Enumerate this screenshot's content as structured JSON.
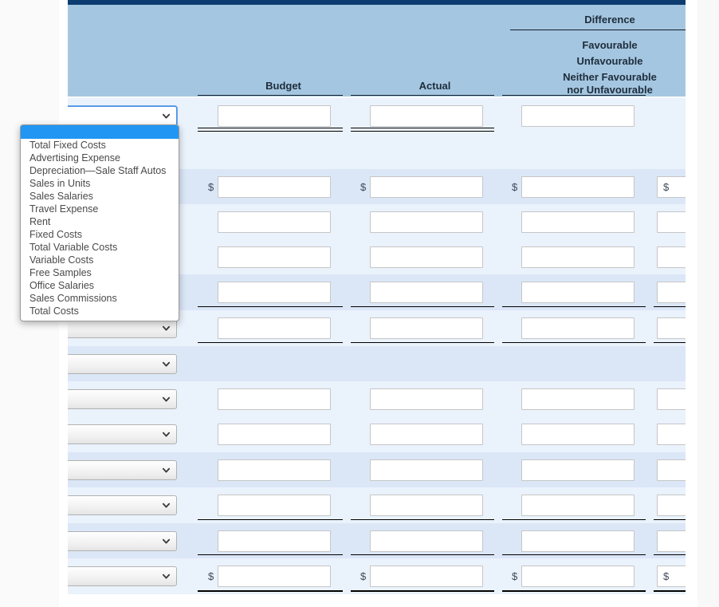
{
  "worksheet": {
    "column_headers": {
      "budget": "Budget",
      "actual": "Actual",
      "difference": "Difference",
      "difference_note_line1": "Favourable",
      "difference_note_line2": "Unfavourable",
      "difference_note_line3": "Neither Favourable",
      "difference_note_line4": "nor Unfavourable"
    },
    "row_currency_symbol": "$",
    "rows": [
      {
        "id": 1,
        "stripe": "light",
        "has_select": true,
        "select_focused": true,
        "inputs": 3,
        "dollar": false,
        "rule_below": "double"
      },
      {
        "id": 2,
        "stripe": "light",
        "has_select": false,
        "select_focused": false,
        "inputs": 0,
        "dollar": false,
        "rule_below": "none"
      },
      {
        "id": 3,
        "stripe": "dark",
        "has_select": true,
        "select_focused": false,
        "inputs": 4,
        "dollar": true,
        "rule_below": "none"
      },
      {
        "id": 4,
        "stripe": "light",
        "has_select": true,
        "select_focused": false,
        "inputs": 4,
        "dollar": false,
        "rule_below": "none"
      },
      {
        "id": 5,
        "stripe": "light",
        "has_select": true,
        "select_focused": false,
        "inputs": 4,
        "dollar": false,
        "rule_below": "none"
      },
      {
        "id": 6,
        "stripe": "dark",
        "has_select": true,
        "select_focused": false,
        "inputs": 4,
        "dollar": false,
        "rule_below": "single"
      },
      {
        "id": 7,
        "stripe": "light",
        "has_select": true,
        "select_focused": false,
        "inputs": 4,
        "dollar": false,
        "rule_below": "single"
      },
      {
        "id": 8,
        "stripe": "dark",
        "has_select": true,
        "select_focused": false,
        "inputs": 0,
        "dollar": false,
        "rule_below": "none"
      },
      {
        "id": 9,
        "stripe": "light",
        "has_select": true,
        "select_focused": false,
        "inputs": 4,
        "dollar": false,
        "rule_below": "none"
      },
      {
        "id": 10,
        "stripe": "light",
        "has_select": true,
        "select_focused": false,
        "inputs": 4,
        "dollar": false,
        "rule_below": "none"
      },
      {
        "id": 11,
        "stripe": "dark",
        "has_select": true,
        "select_focused": false,
        "inputs": 4,
        "dollar": false,
        "rule_below": "none"
      },
      {
        "id": 12,
        "stripe": "light",
        "has_select": true,
        "select_focused": false,
        "inputs": 4,
        "dollar": false,
        "rule_below": "single"
      },
      {
        "id": 13,
        "stripe": "dark",
        "has_select": true,
        "select_focused": false,
        "inputs": 4,
        "dollar": false,
        "rule_below": "single"
      },
      {
        "id": 14,
        "stripe": "light",
        "has_select": true,
        "select_focused": false,
        "inputs": 4,
        "dollar": true,
        "rule_below": "thick"
      }
    ]
  },
  "dropdown": {
    "open": true,
    "selected_index": 0,
    "options": [
      "",
      "Total Fixed Costs",
      "Advertising Expense",
      "Depreciation—Sale Staff Autos",
      "Sales in Units",
      "Sales Salaries",
      "Travel Expense",
      "Rent",
      "Fixed Costs",
      "Total Variable Costs",
      "Variable Costs",
      "Free Samples",
      "Office Salaries",
      "Sales Commissions",
      "Total Costs"
    ]
  },
  "colors": {
    "header_band": "#a5c6e0",
    "top_bar": "#0d3c71",
    "row_light": "#eaf2fc",
    "row_dark": "#dbe7f7",
    "highlight": "#2196f3",
    "page": "#ffffff"
  }
}
